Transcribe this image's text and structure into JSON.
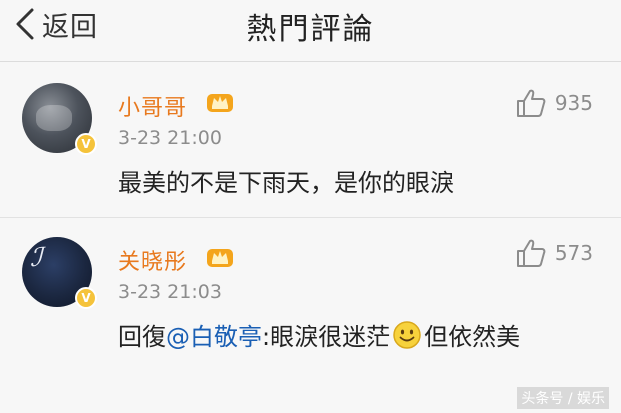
{
  "header": {
    "back_label": "返回",
    "title": "熱門評論"
  },
  "comments": [
    {
      "username": "小哥哥",
      "timestamp": "3-23 21:00",
      "likes": "935",
      "text": "最美的不是下雨天，是你的眼淚"
    },
    {
      "username": "关晓彤",
      "timestamp": "3-23 21:03",
      "likes": "573",
      "reply_prefix": "回復",
      "mention": "@白敬亭",
      "text_before_emoji": ":眼淚很迷茫",
      "text_after_emoji": "但依然美"
    }
  ],
  "icons": {
    "back": "chevron-left-icon",
    "like": "thumbs-up-icon",
    "crown": "crown-badge-icon",
    "verified": "verified-v-icon",
    "emoji": "smiley-face-icon"
  },
  "colors": {
    "username": "#e8791e",
    "mention": "#1a5fb4",
    "verified": "#f5c33b"
  },
  "watermark": "头条号 / 娱乐"
}
